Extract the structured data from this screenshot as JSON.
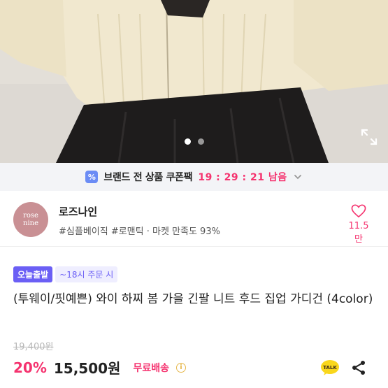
{
  "carousel": {
    "total": 2,
    "active": 1
  },
  "coupon": {
    "icon": "coupon-percent-icon",
    "label": "브랜드 전 상품 쿠폰팩",
    "timer": "19 : 29 : 21 남음"
  },
  "shop": {
    "logo_line1": "rose",
    "logo_line2": "nine",
    "name": "로즈나인",
    "tags": "#심플베이직 #로맨틱 · 마켓 만족도 93%",
    "likes": "11.5만"
  },
  "badges": {
    "today": "오늘출발",
    "cutoff": "~18시 주문 시"
  },
  "product": {
    "title": "(투웨이/핏예쁜) 와이 하찌 봄 가을 긴팔 니트 후드 집업 가디건 (4color)",
    "original_price": "19,400원",
    "discount": "20%",
    "price": "15,500원",
    "shipping": "무료배송",
    "info_icon": "i"
  },
  "colors": {
    "accent": "#f5336f",
    "badge": "#6b5ff5",
    "coupon_icon": "#6b8cf5",
    "logo_bg": "#c99094"
  }
}
